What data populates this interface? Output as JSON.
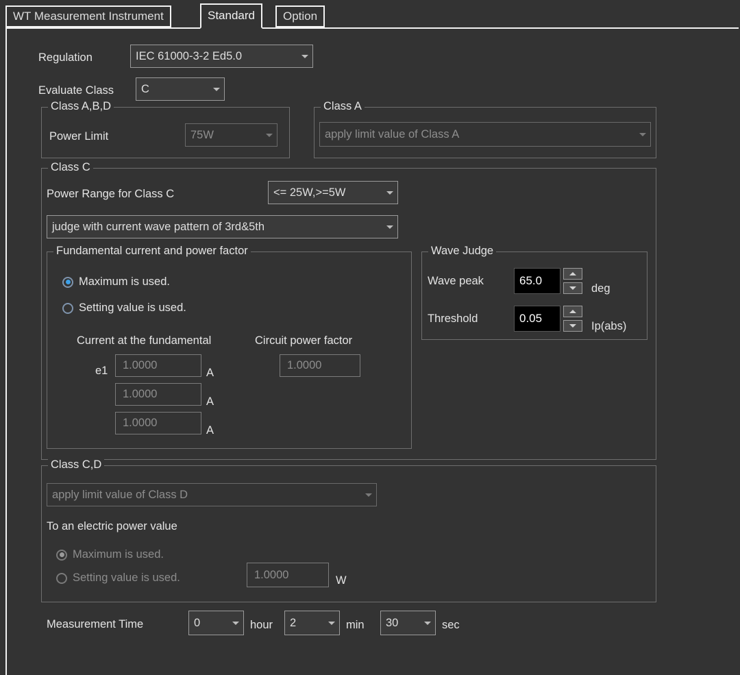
{
  "tabs": [
    {
      "label": "WT Measurement Instrument",
      "active": false
    },
    {
      "label": "Standard",
      "active": true
    },
    {
      "label": "Option",
      "active": false
    }
  ],
  "form": {
    "regulation_label": "Regulation",
    "regulation_value": "IEC 61000-3-2 Ed5.0",
    "evaluate_class_label": "Evaluate Class",
    "evaluate_class_value": "C"
  },
  "class_abd": {
    "title": "Class A,B,D",
    "power_limit_label": "Power Limit",
    "power_limit_value": "75W"
  },
  "class_a": {
    "title": "Class A",
    "limit_value": "apply limit value of Class A"
  },
  "class_c": {
    "title": "Class C",
    "power_range_label": "Power Range for Class C",
    "power_range_value": "<= 25W,>=5W",
    "judge_mode_value": "judge with current wave pattern of 3rd&5th",
    "fundamental": {
      "title": "Fundamental current and power factor",
      "radio_maximum": "Maximum is used.",
      "radio_setting": "Setting value is used.",
      "selected": "maximum",
      "col_current_label": "Current at the fundamental",
      "col_pf_label": "Circuit power factor",
      "e1_label": "e1",
      "current_values": [
        "1.0000",
        "1.0000",
        "1.0000"
      ],
      "current_unit": "A",
      "power_factor_value": "1.0000"
    },
    "wave_judge": {
      "title": "Wave Judge",
      "wave_peak_label": "Wave peak",
      "wave_peak_value": "65.0",
      "wave_peak_unit": "deg",
      "threshold_label": "Threshold",
      "threshold_value": "0.05",
      "threshold_unit": "Ip(abs)"
    }
  },
  "class_cd": {
    "title": "Class C,D",
    "limit_value": "apply limit value of Class D",
    "electric_power_label": "To an electric power value",
    "radio_maximum": "Maximum is used.",
    "radio_setting": "Setting value is used.",
    "selected": "maximum",
    "power_value": "1.0000",
    "power_unit": "W"
  },
  "measurement_time": {
    "label": "Measurement Time",
    "hour_value": "0",
    "hour_unit": "hour",
    "min_value": "2",
    "min_unit": "min",
    "sec_value": "30",
    "sec_unit": "sec"
  },
  "icons": {
    "chevron_down": "chevron-down-icon",
    "spinner_up": "spinner-up-icon",
    "spinner_down": "spinner-down-icon"
  },
  "colors": {
    "background": "#333333",
    "frame": "#f2f2f2",
    "border": "#6e6e6e",
    "accent": "#3da0e8",
    "text": "#e4e4e4",
    "text_disabled": "#8c8c8c"
  }
}
